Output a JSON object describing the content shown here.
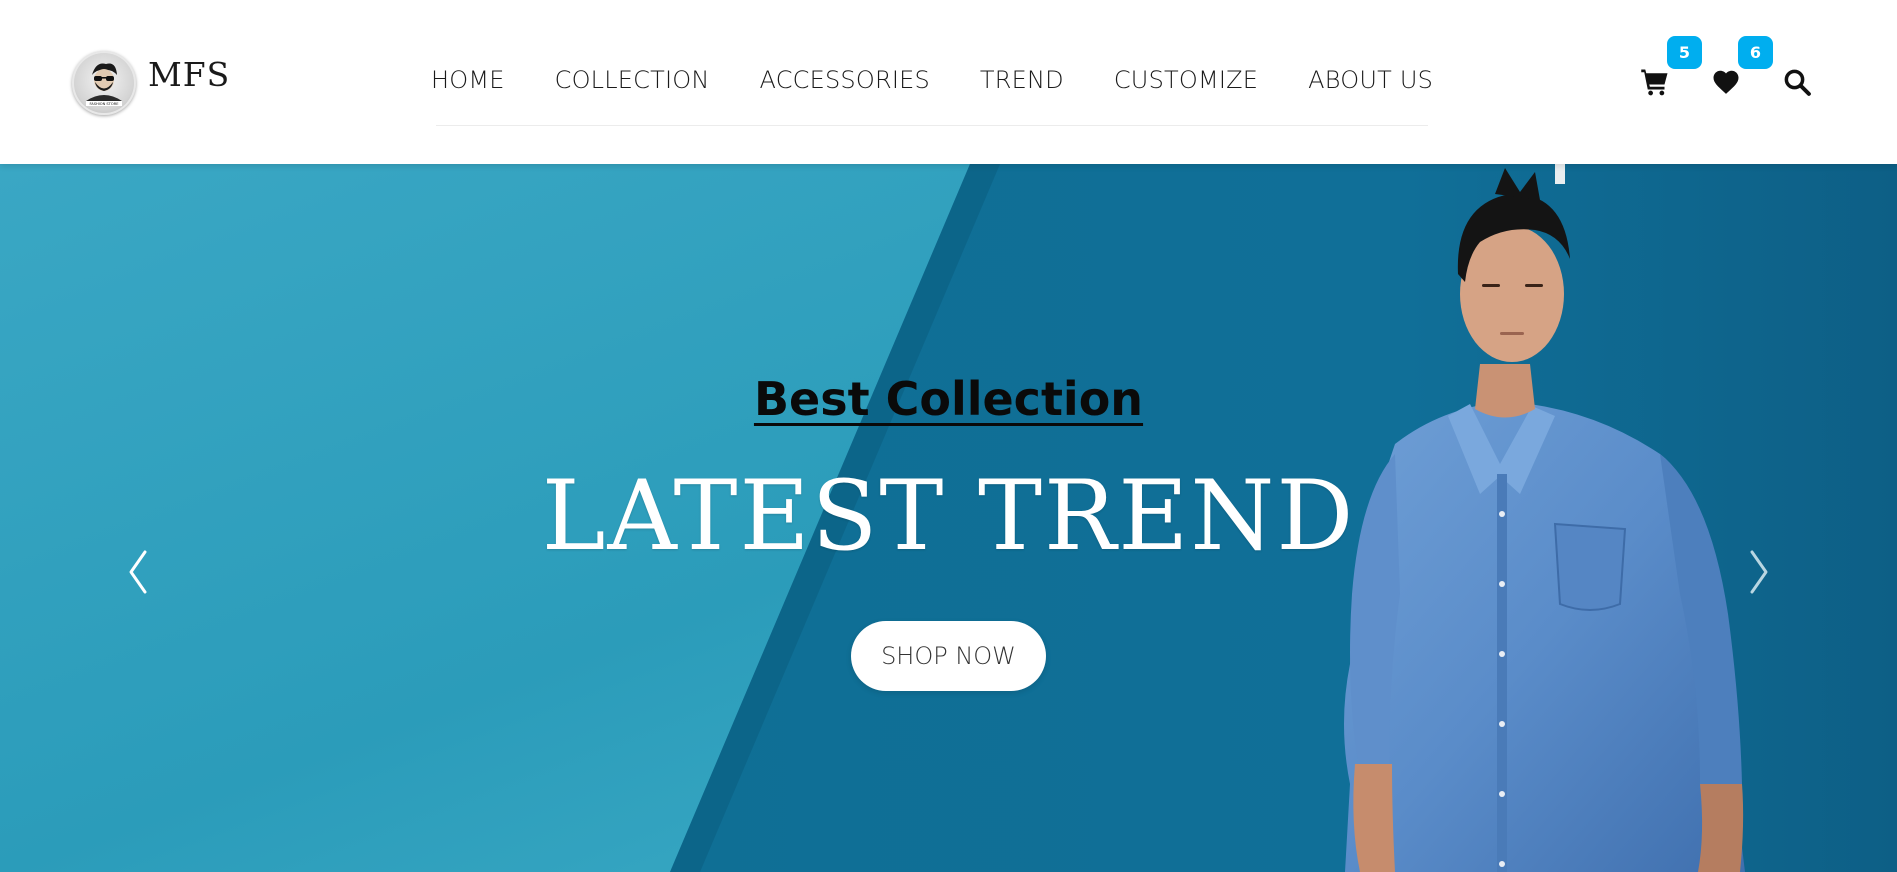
{
  "brand": {
    "name": "MFS",
    "logo_text": "FASHION STORE"
  },
  "nav": {
    "items": [
      {
        "label": "HOME"
      },
      {
        "label": "COLLECTION"
      },
      {
        "label": "ACCESSORIES"
      },
      {
        "label": "TREND"
      },
      {
        "label": "CUSTOMIZE"
      },
      {
        "label": "ABOUT US"
      }
    ]
  },
  "header_icons": {
    "cart": {
      "icon": "cart-icon",
      "count": "5"
    },
    "wishlist": {
      "icon": "heart-icon",
      "count": "6"
    },
    "search": {
      "icon": "search-icon"
    }
  },
  "hero": {
    "eyebrow": "Best Collection",
    "title": "LATEST TREND",
    "cta_label": "SHOP NOW",
    "prev_icon": "chevron-left-icon",
    "next_icon": "chevron-right-icon"
  },
  "colors": {
    "accent": "#00aeef",
    "hero_bg": "#1f8fae",
    "header_bg": "#ffffff"
  }
}
